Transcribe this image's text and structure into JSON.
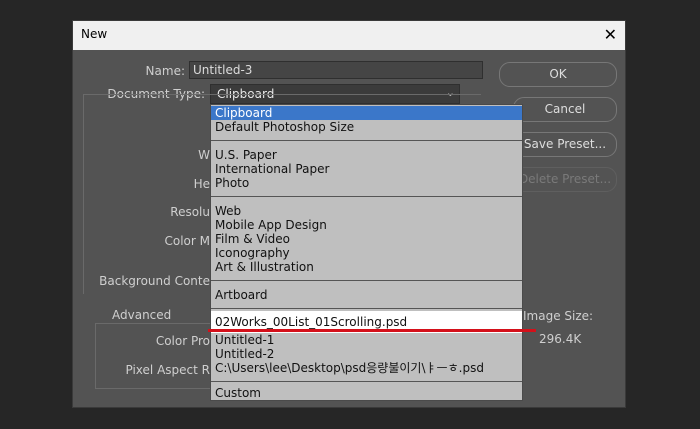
{
  "dialog": {
    "title": "New",
    "close_glyph": "✕"
  },
  "form": {
    "name_label": "Name:",
    "name_value": "Untitled-3",
    "doctype_label": "Document Type:",
    "doctype_value": "Clipboard",
    "width_label": "W",
    "height_label": "He",
    "resolution_label": "Resolu",
    "colormode_label": "Color M",
    "background_label": "Background Conte",
    "advanced_label": "Advanced",
    "colorprofile_label": "Color Pro",
    "pixelaspect_label": "Pixel Aspect R"
  },
  "buttons": {
    "ok": "OK",
    "cancel": "Cancel",
    "save_preset": "Save Preset...",
    "delete_preset": "Delete Preset..."
  },
  "image_size": {
    "label": "Image Size:",
    "value": "296.4K"
  },
  "dropdown": {
    "items": [
      "Clipboard",
      "Default Photoshop Size",
      "U.S. Paper",
      "International Paper",
      "Photo",
      "Web",
      "Mobile App Design",
      "Film & Video",
      "Iconography",
      "Art & Illustration",
      "Artboard",
      "02Works_00List_01Scrolling.psd",
      "Untitled-1",
      "Untitled-2",
      "C:\\Users\\lee\\Desktop\\psd응량불이기\\ㅑㅡㅎ.psd",
      "Custom"
    ]
  },
  "colors": {
    "selection": "#3b77c9",
    "highlight": "#ffffff",
    "annotation": "#d4101a"
  }
}
